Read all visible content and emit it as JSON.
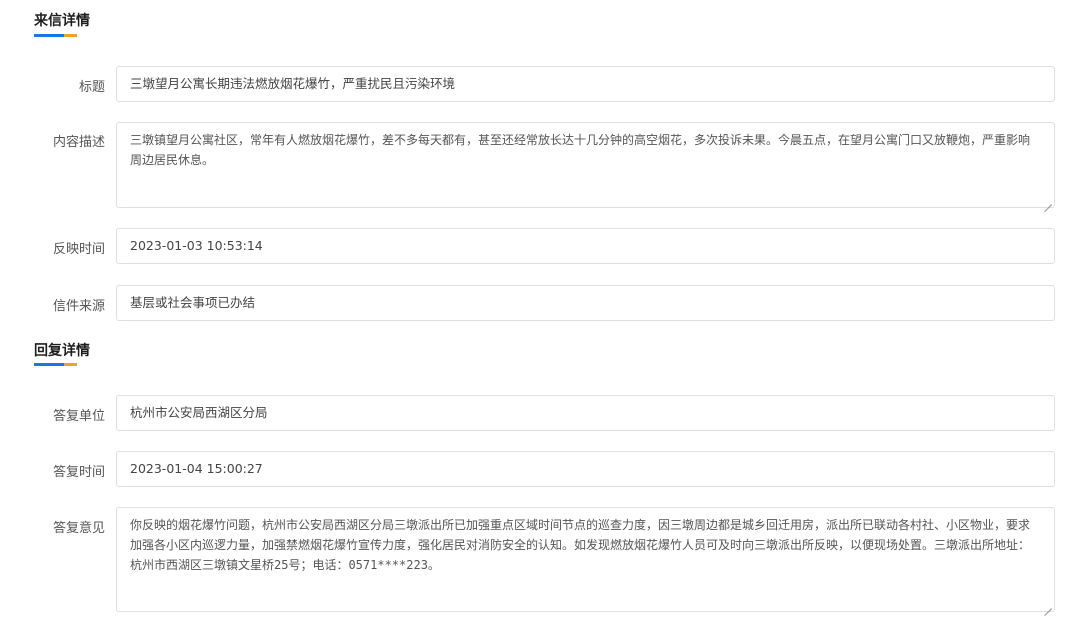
{
  "letter": {
    "section_title": "来信详情",
    "fields": {
      "title": {
        "label": "标题",
        "value": "三墩望月公寓长期违法燃放烟花爆竹，严重扰民且污染环境"
      },
      "content": {
        "label": "内容描述",
        "value": "三墩镇望月公寓社区，常年有人燃放烟花爆竹，差不多每天都有，甚至还经常放长达十几分钟的高空烟花，多次投诉未果。今晨五点，在望月公寓门口又放鞭炮，严重影响周边居民休息。"
      },
      "time": {
        "label": "反映时间",
        "value": "2023-01-03 10:53:14"
      },
      "source": {
        "label": "信件来源",
        "value": "基层或社会事项已办结"
      }
    }
  },
  "reply": {
    "section_title": "回复详情",
    "fields": {
      "unit": {
        "label": "答复单位",
        "value": "杭州市公安局西湖区分局"
      },
      "time": {
        "label": "答复时间",
        "value": "2023-01-04 15:00:27"
      },
      "opinion": {
        "label": "答复意见",
        "value": "你反映的烟花爆竹问题，杭州市公安局西湖区分局三墩派出所已加强重点区域时间节点的巡查力度，因三墩周边都是城乡回迁用房，派出所已联动各村社、小区物业，要求加强各小区内巡逻力量，加强禁燃烟花爆竹宣传力度，强化居民对消防安全的认知。如发现燃放烟花爆竹人员可及时向三墩派出所反映，以便现场处置。三墩派出所地址：杭州市西湖区三墩镇文星桥25号；电话：0571****223。"
      }
    }
  },
  "colors": {
    "accent_blue": "#1677e6",
    "accent_orange": "#f5a020",
    "border": "#dcdfe6"
  }
}
